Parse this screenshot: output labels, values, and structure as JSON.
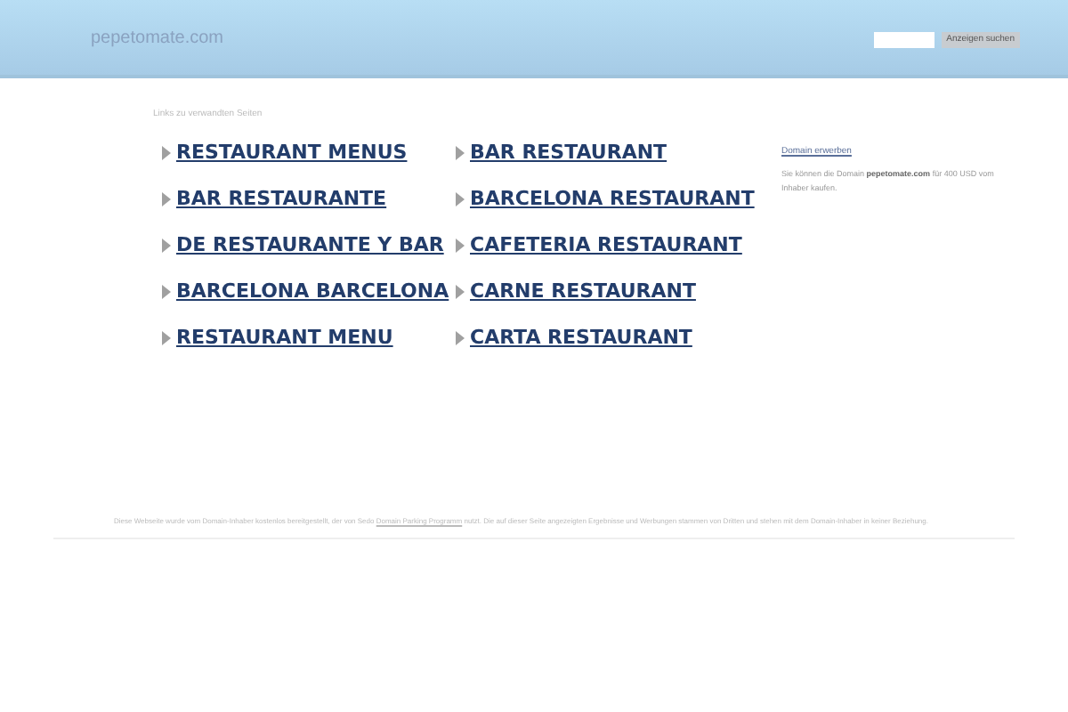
{
  "header": {
    "domain": "pepetomate.com",
    "search_button": "Anzeigen suchen"
  },
  "links_heading": "Links zu verwandten Seiten",
  "links": [
    {
      "label": "RESTAURANT MENUS"
    },
    {
      "label": "BAR RESTAURANT"
    },
    {
      "label": "BAR RESTAURANTE"
    },
    {
      "label": "BARCELONA RESTAURANT"
    },
    {
      "label": "DE RESTAURANTE Y BAR"
    },
    {
      "label": "CAFETERIA RESTAURANT"
    },
    {
      "label": "BARCELONA BARCELONA"
    },
    {
      "label": "CARNE RESTAURANT"
    },
    {
      "label": "RESTAURANT MENU"
    },
    {
      "label": "CARTA RESTAURANT"
    }
  ],
  "sidebar": {
    "title": "Domain erwerben",
    "text_before": "Sie können die Domain",
    "domain": "pepetomate.com",
    "text_after": "für 400 USD vom Inhaber kaufen."
  },
  "footer": {
    "text_before": "Diese Webseite wurde vom Domain-Inhaber kostenlos bereitgestellt, der von Sedo",
    "link": "Domain Parking Programm",
    "text_after": "nutzt. Die auf dieser Seite angezeigten Ergebnisse und Werbungen stammen von Dritten und stehen mit dem Domain-Inhaber in keiner Beziehung."
  }
}
